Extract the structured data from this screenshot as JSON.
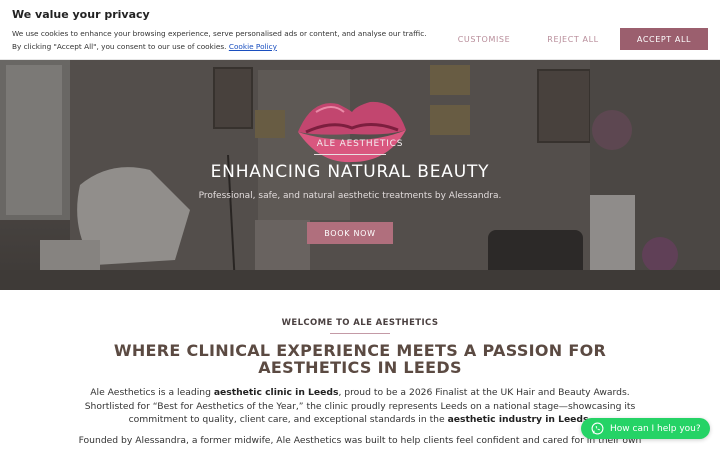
{
  "cookie": {
    "title": "We value your privacy",
    "text_part1": "We use cookies to enhance your browsing experience, serve personalised ads or content, and analyse our traffic. By clicking \"Accept All\", you consent to our use of cookies.",
    "policy_link": "Cookie Policy",
    "customise_label": "CUSTOMISE",
    "reject_label": "REJECT ALL",
    "accept_label": "ACCEPT ALL"
  },
  "hero": {
    "brand": "ALE AESTHETICS",
    "title": "ENHANCING NATURAL BEAUTY",
    "subtitle": "Professional, safe, and natural aesthetic treatments by Alessandra.",
    "cta_label": "BOOK NOW",
    "logo_icon": "lips-logo-icon"
  },
  "welcome": {
    "label": "WELCOME TO ALE AESTHETICS",
    "headline": "WHERE CLINICAL EXPERIENCE MEETS A PASSION FOR AESTHETICS IN LEEDS",
    "p1_a": "Ale Aesthetics is a leading ",
    "p1_b": "aesthetic clinic in Leeds",
    "p1_c": ", proud to be a 2026 Finalist at the UK Hair and Beauty Awards. Shortlisted for “Best for Aesthetics of the Year,” the clinic proudly represents Leeds on a national stage—showcasing its commitment to quality, client care, and exceptional standards in the ",
    "p1_d": "aesthetic industry in Leeds",
    "p1_e": ".",
    "p2": "Founded by Alessandra, a former midwife, Ale Aesthetics was built to help clients feel confident and cared for in their own"
  },
  "whatsapp": {
    "label": "How can I help you?",
    "icon": "whatsapp-icon"
  },
  "colors": {
    "accent": "#9b5f6e",
    "cta": "#b06f7d",
    "headline": "#5b4a42",
    "whatsapp": "#25d366"
  }
}
